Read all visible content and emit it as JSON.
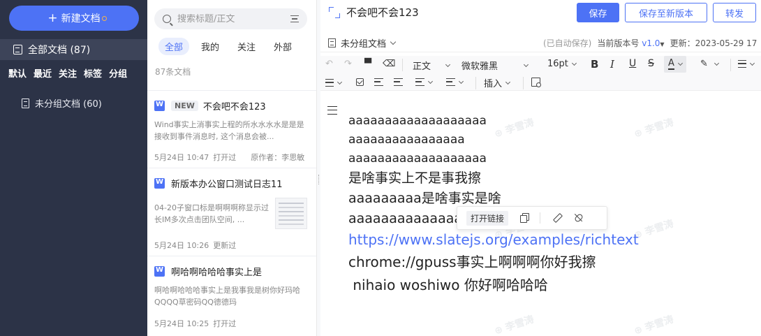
{
  "sidebar": {
    "new_doc_label": "新建文档",
    "all_docs_label": "全部文档 (87)",
    "filters": [
      "默认",
      "最近",
      "关注",
      "标签",
      "分组"
    ],
    "groups": [
      {
        "label": "未分组文档 (60)"
      }
    ]
  },
  "list": {
    "search_placeholder": "搜索标题/正文",
    "tabs": [
      {
        "label": "全部",
        "active": true
      },
      {
        "label": "我的",
        "active": false
      },
      {
        "label": "关注",
        "active": false
      },
      {
        "label": "外部",
        "active": false
      }
    ],
    "count_label": "87条文档",
    "items": [
      {
        "new_tag": "NEW",
        "title": "不会吧不会123",
        "snippet": "Wind事实上消事实上程的所水水水水是是是接收到事件消息时, 这个消息会被...",
        "time": "5月24日 10:47",
        "status": "打开过",
        "author": "原作者：李思敏"
      },
      {
        "title": "新版本办公窗口测试日志11",
        "snippet": "04-20子窗口标是啊啊啊称显示过长IM多次点击团队空间, ...",
        "time": "5月24日 10:26",
        "status": "更新过"
      },
      {
        "title": "啊哈啊哈哈哈事实上是",
        "snippet": "啊哈啊哈哈哈事实上是我事我是树你好玛哈QQQQ草密码QQ德德玛",
        "time": "5月24日 10:25",
        "status": "打开过"
      }
    ]
  },
  "editor": {
    "title": "不会吧不会123",
    "save_label": "保存",
    "save_new_label": "保存至新版本",
    "forward_label": "转发",
    "group_label": "未分组文档",
    "autosave": "(已自动保存)",
    "version_label": "当前版本号",
    "version": "v1.0",
    "updated_label": "更新：",
    "updated": "2023-05-29 17",
    "toolbar": {
      "style": "正文",
      "font": "微软雅黑",
      "size": "16pt",
      "bold": "B",
      "italic": "I",
      "underline": "U",
      "strike": "S",
      "color": "A",
      "insert": "插入"
    },
    "content_lines": [
      "aaaaaaaaaaaaaaaaaaa",
      "aaaaaaaaaaaaaaaa",
      "aaaaaaaaaaaaaaaaaaa",
      "是啥事实上不是事我擦",
      "aaaaaaaaa是啥事实是啥",
      "aaaaaaaaaaaaaa"
    ],
    "link_text": "https://www.slatejs.org/examples/richtext",
    "tail_lines": [
      "chrome://gpuss事实上啊啊啊你好我擦",
      " nihaio woshiwo 你好啊哈哈哈"
    ],
    "link_popup": {
      "open_label": "打开链接"
    }
  },
  "colors": {
    "accent": "#4d72f5",
    "sidebar_bg": "#2c3347",
    "sidebar_active": "#3d4459"
  }
}
